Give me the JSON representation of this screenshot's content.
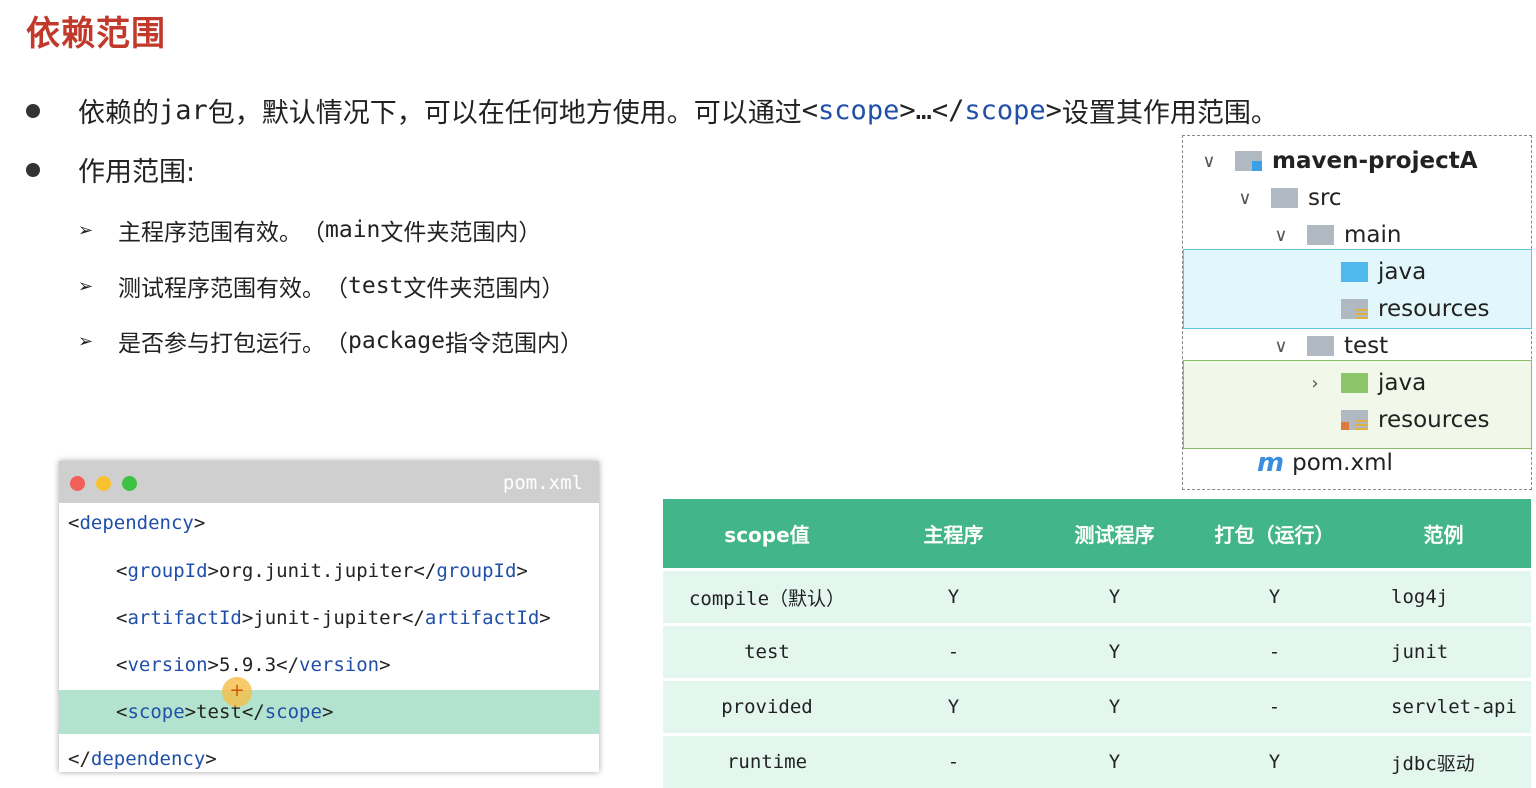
{
  "title": "依赖范围",
  "bullet1": {
    "prefix": "依赖的",
    "jar": "jar",
    "middle": "包，默认情况下，可以在任何地方使用。可以通过 ",
    "lt1": "<",
    "scope1": "scope",
    "gt_ellipsis": ">…</",
    "scope2": "scope",
    "gt2": ">",
    "suffix": " 设置其作用范围。"
  },
  "bullet2": "作用范围:",
  "subitems": [
    {
      "text": "主程序范围有效。",
      "paren_open": "（",
      "code": "main",
      "rest": "文件夹范围内）"
    },
    {
      "text": "测试程序范围有效。",
      "paren_open": "（",
      "code": "test",
      "rest": "文件夹范围内）"
    },
    {
      "text": "是否参与打包运行。",
      "paren_open": "（",
      "code": "package",
      "rest": "指令范围内）"
    }
  ],
  "code_window": {
    "filename": "pom.xml",
    "lines": {
      "l1_open": "<",
      "l1_tag": "dependency",
      "l1_close": ">",
      "l2_open": "<",
      "l2_tag": "groupId",
      "l2_mid": ">org.junit.jupiter</",
      "l2_tag2": "groupId",
      "l2_close": ">",
      "l3_open": "<",
      "l3_tag": "artifactId",
      "l3_mid": ">junit-jupiter</",
      "l3_tag2": "artifactId",
      "l3_close": ">",
      "l4_open": "<",
      "l4_tag": "version",
      "l4_mid": ">5.9.3</",
      "l4_tag2": "version",
      "l4_close": ">",
      "l5_open": "<",
      "l5_tag": "scope",
      "l5_mid": ">test</",
      "l5_tag2": "scope",
      "l5_close": ">",
      "l6_open": "</",
      "l6_tag": "dependency",
      "l6_close": ">"
    }
  },
  "tree": {
    "root": "maven-projectA",
    "src": "src",
    "main": "main",
    "main_java": "java",
    "main_resources": "resources",
    "test": "test",
    "test_java": "java",
    "test_resources": "resources",
    "pom_logo": "m",
    "pom": "pom.xml"
  },
  "table": {
    "headers": [
      "scope值",
      "主程序",
      "测试程序",
      "打包（运行）",
      "范例"
    ],
    "rows": [
      [
        "compile（默认）",
        "Y",
        "Y",
        "Y",
        "log4j"
      ],
      [
        "test",
        "-",
        "Y",
        "-",
        "junit"
      ],
      [
        "provided",
        "Y",
        "Y",
        "-",
        "servlet-api"
      ],
      [
        "runtime",
        "-",
        "Y",
        "Y",
        "jdbc驱动"
      ]
    ]
  },
  "colors": {
    "title": "#c0392b",
    "xml_tag": "#1f4fa8",
    "table_header": "#42b58a",
    "table_row": "#e4f7ef",
    "highlight_line": "#b3e3cf"
  }
}
